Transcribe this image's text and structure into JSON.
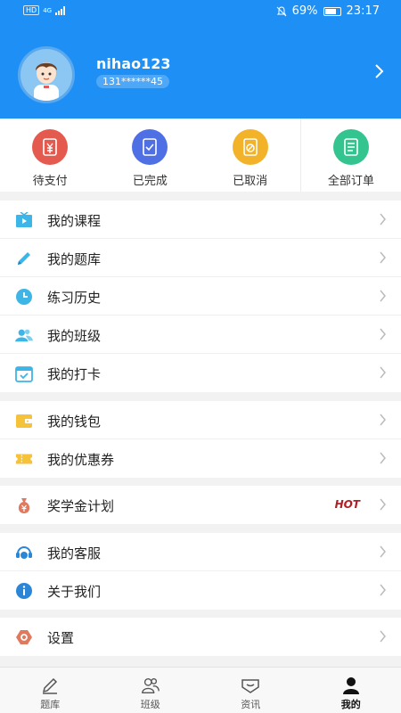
{
  "status_bar": {
    "network": "HD",
    "net_gen": "4G",
    "battery": "69%",
    "time": "23:17"
  },
  "profile": {
    "username": "nihao123",
    "phone": "131******45"
  },
  "orders": [
    {
      "label": "待支付",
      "icon": "yen-icon",
      "color": "#e45a4e"
    },
    {
      "label": "已完成",
      "icon": "check-icon",
      "color": "#4f6fe4"
    },
    {
      "label": "已取消",
      "icon": "cancel-icon",
      "color": "#f2b32a"
    },
    {
      "label": "全部订单",
      "icon": "list-icon",
      "color": "#34c490"
    }
  ],
  "menu": {
    "courses": "我的课程",
    "question_bank": "我的题库",
    "history": "练习历史",
    "class": "我的班级",
    "checkin": "我的打卡",
    "wallet": "我的钱包",
    "coupons": "我的优惠券",
    "scholarship": "奖学金计划",
    "hot": "HOT",
    "service": "我的客服",
    "about": "关于我们",
    "settings": "设置"
  },
  "tabs": [
    {
      "label": "题库",
      "icon": "pencil-icon"
    },
    {
      "label": "班级",
      "icon": "people-icon"
    },
    {
      "label": "资讯",
      "icon": "message-icon"
    },
    {
      "label": "我的",
      "icon": "person-icon",
      "active": true
    }
  ],
  "colors": {
    "header_bg": "#1e90f5",
    "hot": "#b31e24"
  }
}
